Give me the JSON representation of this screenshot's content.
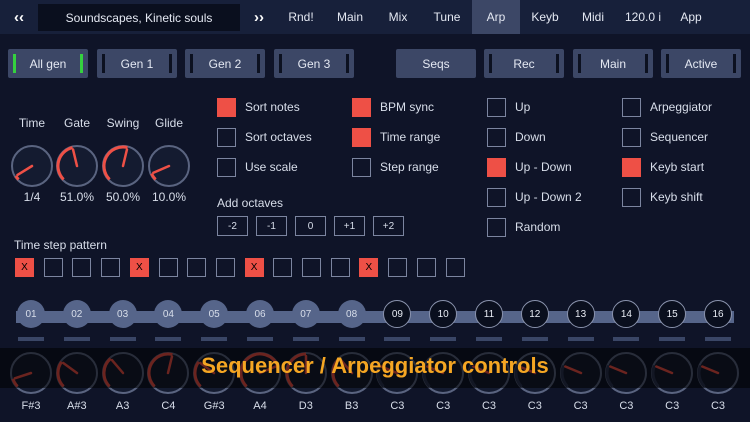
{
  "topbar": {
    "back_arrow": "‹‹",
    "preset_name": "Soundscapes, Kinetic souls",
    "forward_arrow": "››",
    "tabs": [
      "Rnd!",
      "Main",
      "Mix",
      "Tune",
      "Arp",
      "Keyb",
      "Midi",
      "120.0 i",
      "App"
    ],
    "active_tab": "Arp"
  },
  "sections": {
    "left": [
      "All gen",
      "Gen 1",
      "Gen 2",
      "Gen 3"
    ],
    "right": [
      "Seqs",
      "Rec",
      "Main",
      "Active"
    ]
  },
  "knobs": [
    {
      "label": "Time",
      "value": "1/4",
      "level": 0.05
    },
    {
      "label": "Gate",
      "value": "51.0%",
      "level": 0.45
    },
    {
      "label": "Swing",
      "value": "50.0%",
      "level": 0.55
    },
    {
      "label": "Glide",
      "value": "10.0%",
      "level": 0.08
    }
  ],
  "options_col1": [
    {
      "label": "Sort notes",
      "checked": true
    },
    {
      "label": "Sort octaves",
      "checked": false
    },
    {
      "label": "Use scale",
      "checked": false
    }
  ],
  "options_col2": [
    {
      "label": "BPM sync",
      "checked": true
    },
    {
      "label": "Time range",
      "checked": true
    },
    {
      "label": "Step range",
      "checked": false
    }
  ],
  "options_col3": [
    {
      "label": "Up",
      "checked": false
    },
    {
      "label": "Down",
      "checked": false
    },
    {
      "label": "Up - Down",
      "checked": true
    },
    {
      "label": "Up - Down 2",
      "checked": false
    },
    {
      "label": "Random",
      "checked": false
    }
  ],
  "options_col4": [
    {
      "label": "Arpeggiator",
      "checked": false
    },
    {
      "label": "Sequencer",
      "checked": false
    },
    {
      "label": "Keyb start",
      "checked": true
    },
    {
      "label": "Keyb shift",
      "checked": false
    }
  ],
  "add_octaves": {
    "label": "Add octaves",
    "buttons": [
      "-2",
      "-1",
      "0",
      "+1",
      "+2"
    ]
  },
  "time_step_pattern": {
    "label": "Time step pattern",
    "mark": "X",
    "steps": [
      true,
      false,
      false,
      false,
      true,
      false,
      false,
      false,
      true,
      false,
      false,
      false,
      true,
      false,
      false,
      false
    ]
  },
  "sequencer": {
    "steps": [
      "01",
      "02",
      "03",
      "04",
      "05",
      "06",
      "07",
      "08",
      "09",
      "10",
      "11",
      "12",
      "13",
      "14",
      "15",
      "16"
    ],
    "active_count": 8,
    "notes": [
      "F#3",
      "A#3",
      "A3",
      "C4",
      "G#3",
      "A4",
      "D3",
      "B3",
      "C3",
      "C3",
      "C3",
      "C3",
      "C3",
      "C3",
      "C3",
      "C3"
    ],
    "levels": [
      0.1,
      0.3,
      0.35,
      0.55,
      0.3,
      0.75,
      0.5,
      0.35,
      0.25,
      0.25,
      0.25,
      0.25,
      0.25,
      0.25,
      0.25,
      0.25
    ]
  },
  "overlay_caption": "Sequencer / Arpeggiator controls",
  "colors": {
    "background": "#0f1428",
    "accent": "#ee5046",
    "panel": "#3c4766",
    "active_indicator": "#35d13f",
    "caption": "#f5a623"
  }
}
